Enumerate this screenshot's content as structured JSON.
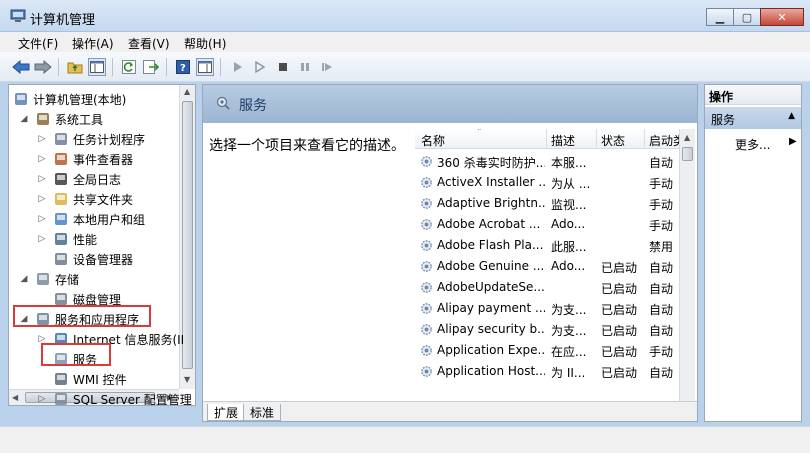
{
  "window": {
    "title": "计算机管理"
  },
  "menu": [
    "文件(F)",
    "操作(A)",
    "查看(V)",
    "帮助(H)"
  ],
  "tree": [
    {
      "label": "计算机管理(本地)",
      "exp": "",
      "level": 0,
      "icon": "computer-icon"
    },
    {
      "label": "系统工具",
      "exp": "◢",
      "level": 1,
      "icon": "tools-icon"
    },
    {
      "label": "任务计划程序",
      "exp": "▷",
      "level": 2,
      "icon": "clock-icon"
    },
    {
      "label": "事件查看器",
      "exp": "▷",
      "level": 2,
      "icon": "event-viewer-icon"
    },
    {
      "label": "全局日志",
      "exp": "▷",
      "level": 2,
      "icon": "log-icon"
    },
    {
      "label": "共享文件夹",
      "exp": "▷",
      "level": 2,
      "icon": "shared-folder-icon"
    },
    {
      "label": "本地用户和组",
      "exp": "▷",
      "level": 2,
      "icon": "users-icon"
    },
    {
      "label": "性能",
      "exp": "▷",
      "level": 2,
      "icon": "performance-icon"
    },
    {
      "label": "设备管理器",
      "exp": "",
      "level": 2,
      "icon": "device-manager-icon"
    },
    {
      "label": "存储",
      "exp": "◢",
      "level": 1,
      "icon": "storage-icon"
    },
    {
      "label": "磁盘管理",
      "exp": "",
      "level": 2,
      "icon": "disk-icon"
    },
    {
      "label": "服务和应用程序",
      "exp": "◢",
      "level": 1,
      "icon": "services-apps-icon"
    },
    {
      "label": "Internet 信息服务(II",
      "exp": "▷",
      "level": 2,
      "icon": "iis-icon"
    },
    {
      "label": "服务",
      "exp": "",
      "level": 2,
      "icon": "services-icon"
    },
    {
      "label": "WMI 控件",
      "exp": "",
      "level": 2,
      "icon": "wmi-icon"
    },
    {
      "label": "SQL Server 配置管理",
      "exp": "▷",
      "level": 2,
      "icon": "sql-icon"
    }
  ],
  "main": {
    "title": "服务",
    "description": "选择一个项目来查看它的描述。",
    "columns": [
      "名称",
      "描述",
      "状态",
      "启动类"
    ],
    "rows": [
      {
        "name": "360 杀毒实时防护...",
        "desc": "本服...",
        "status": "",
        "startup": "自动"
      },
      {
        "name": "ActiveX Installer ...",
        "desc": "为从 ...",
        "status": "",
        "startup": "手动"
      },
      {
        "name": "Adaptive Brightn...",
        "desc": "监视...",
        "status": "",
        "startup": "手动"
      },
      {
        "name": "Adobe Acrobat ...",
        "desc": "Ado...",
        "status": "",
        "startup": "手动"
      },
      {
        "name": "Adobe Flash Pla...",
        "desc": "此服...",
        "status": "",
        "startup": "禁用"
      },
      {
        "name": "Adobe Genuine ...",
        "desc": "Ado...",
        "status": "已启动",
        "startup": "自动"
      },
      {
        "name": "AdobeUpdateSe...",
        "desc": "",
        "status": "已启动",
        "startup": "自动"
      },
      {
        "name": "Alipay payment ...",
        "desc": "为支...",
        "status": "已启动",
        "startup": "自动"
      },
      {
        "name": "Alipay security b...",
        "desc": "为支...",
        "status": "已启动",
        "startup": "自动"
      },
      {
        "name": "Application Expe...",
        "desc": "在应...",
        "status": "已启动",
        "startup": "手动"
      },
      {
        "name": "Application Host...",
        "desc": "为 II...",
        "status": "已启动",
        "startup": "自动"
      }
    ],
    "tabs": [
      "扩展",
      "标准"
    ]
  },
  "actions": {
    "header": "操作",
    "section": "服务",
    "more": "更多..."
  },
  "colors": {
    "highlight": "#d93a3a",
    "header_bg": "#9db5d2"
  }
}
